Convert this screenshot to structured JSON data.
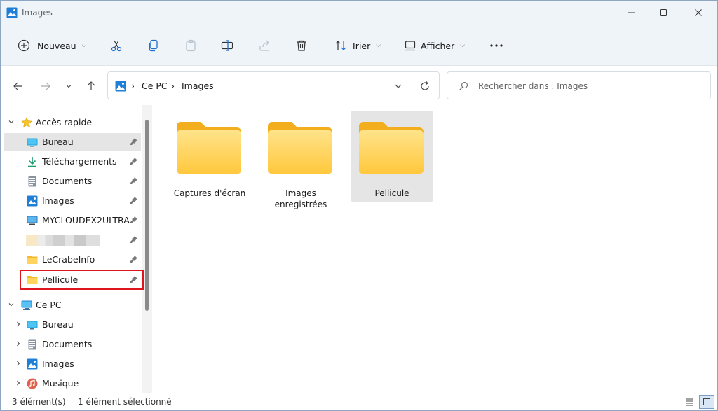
{
  "window": {
    "title": "Images"
  },
  "toolbar": {
    "new_label": "Nouveau",
    "sort_label": "Trier",
    "view_label": "Afficher"
  },
  "address": {
    "crumbs": [
      "Ce PC",
      "Images"
    ]
  },
  "search": {
    "placeholder": "Rechercher dans : Images"
  },
  "sidebar": {
    "quick_access_label": "Accès rapide",
    "quick_items": [
      {
        "label": "Bureau",
        "icon": "desktop-icon"
      },
      {
        "label": "Téléchargements",
        "icon": "download-icon"
      },
      {
        "label": "Documents",
        "icon": "document-icon"
      },
      {
        "label": "Images",
        "icon": "pictures-icon"
      },
      {
        "label": "MYCLOUDEX2ULTRA",
        "icon": "network-drive-icon"
      },
      {
        "label": "",
        "icon": "folder-icon"
      },
      {
        "label": "LeCrabeInfo",
        "icon": "folder-icon"
      },
      {
        "label": "Pellicule",
        "icon": "folder-icon"
      }
    ],
    "this_pc_label": "Ce PC",
    "pc_items": [
      {
        "label": "Bureau",
        "icon": "desktop-icon"
      },
      {
        "label": "Documents",
        "icon": "document-icon"
      },
      {
        "label": "Images",
        "icon": "pictures-icon"
      },
      {
        "label": "Musique",
        "icon": "music-icon"
      }
    ]
  },
  "content": {
    "folders": [
      {
        "name": "Captures d'écran",
        "selected": false
      },
      {
        "name": "Images enregistrées",
        "selected": false
      },
      {
        "name": "Pellicule",
        "selected": true
      }
    ]
  },
  "status": {
    "count": "3 élément(s)",
    "selection": "1 élément sélectionné"
  },
  "colors": {
    "accent": "#0067c0",
    "folder": "#ffc83d",
    "highlight_box": "#e0141e"
  }
}
